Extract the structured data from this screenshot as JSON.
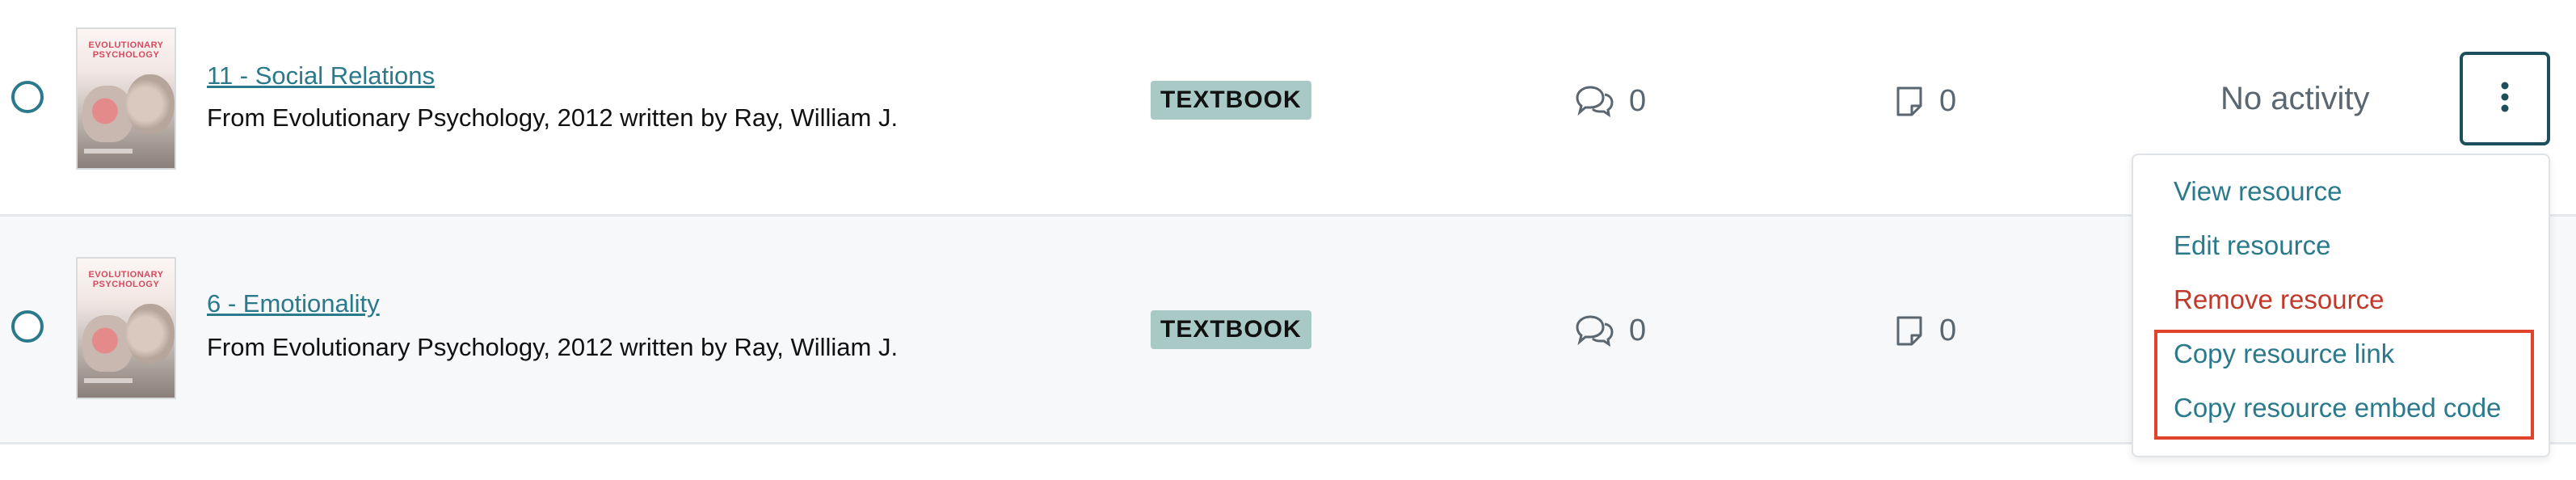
{
  "rows": [
    {
      "title": "11 - Social Relations",
      "source": "From Evolutionary Psychology, 2012 written by Ray, William J.",
      "type_badge": "TEXTBOOK",
      "comment_count": "0",
      "note_count": "0",
      "activity": "No activity",
      "cover_title": "EVOLUTIONARY PSYCHOLOGY"
    },
    {
      "title": "6 - Emotionality",
      "source": "From Evolutionary Psychology, 2012 written by Ray, William J.",
      "type_badge": "TEXTBOOK",
      "comment_count": "0",
      "note_count": "0",
      "cover_title": "EVOLUTIONARY PSYCHOLOGY"
    }
  ],
  "menu": {
    "items": [
      "View resource",
      "Edit resource",
      "Remove resource",
      "Copy resource link",
      "Copy resource embed code"
    ]
  },
  "colors": {
    "link": "#2b7a8c",
    "danger": "#c0392b",
    "badge_bg": "#a8c9c6",
    "highlight": "#e0442c",
    "row_alt_bg": "#f6f8f9"
  },
  "icons": {
    "comments": "comments-icon",
    "notes": "note-icon",
    "menu": "vertical-ellipsis-icon"
  }
}
